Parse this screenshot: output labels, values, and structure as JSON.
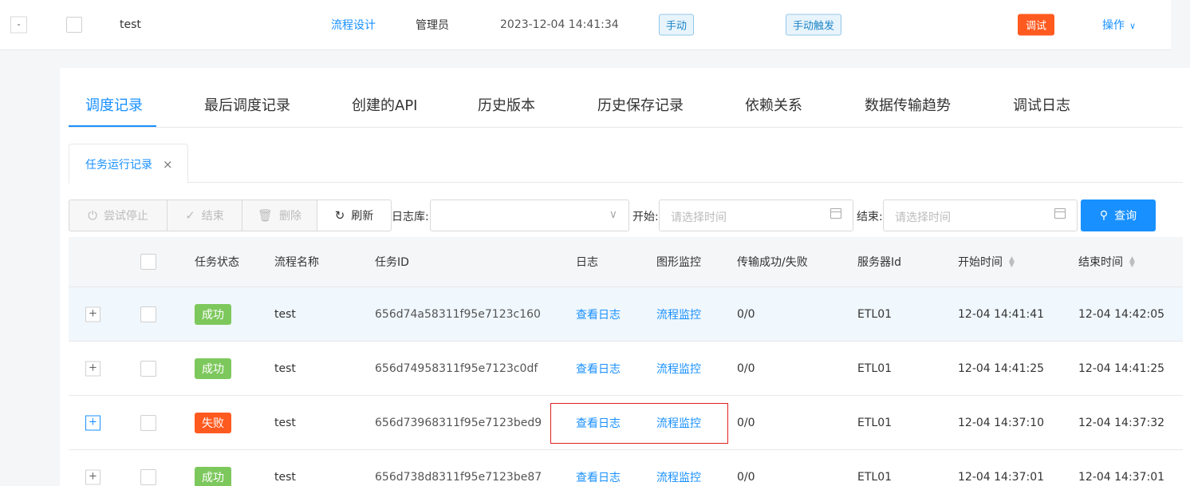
{
  "parent_row": {
    "collapse": "-",
    "name": "test",
    "design_link": "流程设计",
    "owner": "管理员",
    "time": "2023-12-04 14:41:34",
    "mode_tag": "手动",
    "trigger_tag": "手动触发",
    "debug_tag": "调试",
    "operation": "操作",
    "operation_chevron": "∨",
    "colors": {
      "debug": "#ff5a1f",
      "link": "#1890ff"
    }
  },
  "tabs": [
    "调度记录",
    "最后调度记录",
    "创建的API",
    "历史版本",
    "历史保存记录",
    "依赖关系",
    "数据传输趋势",
    "调试日志"
  ],
  "active_tab": "调度记录",
  "subtab": {
    "label": "任务运行记录",
    "close": "×"
  },
  "toolbar": {
    "stop": {
      "icon": "power-icon",
      "label": "尝试停止"
    },
    "finish": {
      "icon": "check-icon",
      "label": "结束"
    },
    "delete": {
      "icon": "trash-icon",
      "label": "删除"
    },
    "refresh": {
      "icon": "refresh-icon",
      "label": "刷新"
    },
    "log_db_label": "日志库:",
    "log_db_value": "",
    "start_label": "开始:",
    "start_placeholder": "请选择时间",
    "end_label": "结束:",
    "end_placeholder": "请选择时间",
    "search_label": "查询"
  },
  "table": {
    "headers": [
      "任务状态",
      "流程名称",
      "任务ID",
      "日志",
      "图形监控",
      "传输成功/失败",
      "服务器Id",
      "开始时间",
      "结束时间"
    ],
    "rows": [
      {
        "expand": "+",
        "status": "成功",
        "status_type": "ok",
        "name": "test",
        "task_id": "656d74a58311f95e7123c160",
        "log": "查看日志",
        "monitor": "流程监控",
        "transfer": "0/0",
        "server": "ETL01",
        "start": "12-04 14:41:41",
        "end": "12-04 14:42:05"
      },
      {
        "expand": "+",
        "status": "成功",
        "status_type": "ok",
        "name": "test",
        "task_id": "656d74958311f95e7123c0df",
        "log": "查看日志",
        "monitor": "流程监控",
        "transfer": "0/0",
        "server": "ETL01",
        "start": "12-04 14:41:25",
        "end": "12-04 14:41:25"
      },
      {
        "expand": "+",
        "status": "失败",
        "status_type": "fail",
        "name": "test",
        "task_id": "656d73968311f95e7123bed9",
        "log": "查看日志",
        "monitor": "流程监控",
        "transfer": "0/0",
        "server": "ETL01",
        "start": "12-04 14:37:10",
        "end": "12-04 14:37:32"
      },
      {
        "expand": "+",
        "status": "成功",
        "status_type": "ok",
        "name": "test",
        "task_id": "656d738d8311f95e7123be87",
        "log": "查看日志",
        "monitor": "流程监控",
        "transfer": "0/0",
        "server": "ETL01",
        "start": "12-04 14:37:01",
        "end": "12-04 14:37:01"
      }
    ]
  }
}
